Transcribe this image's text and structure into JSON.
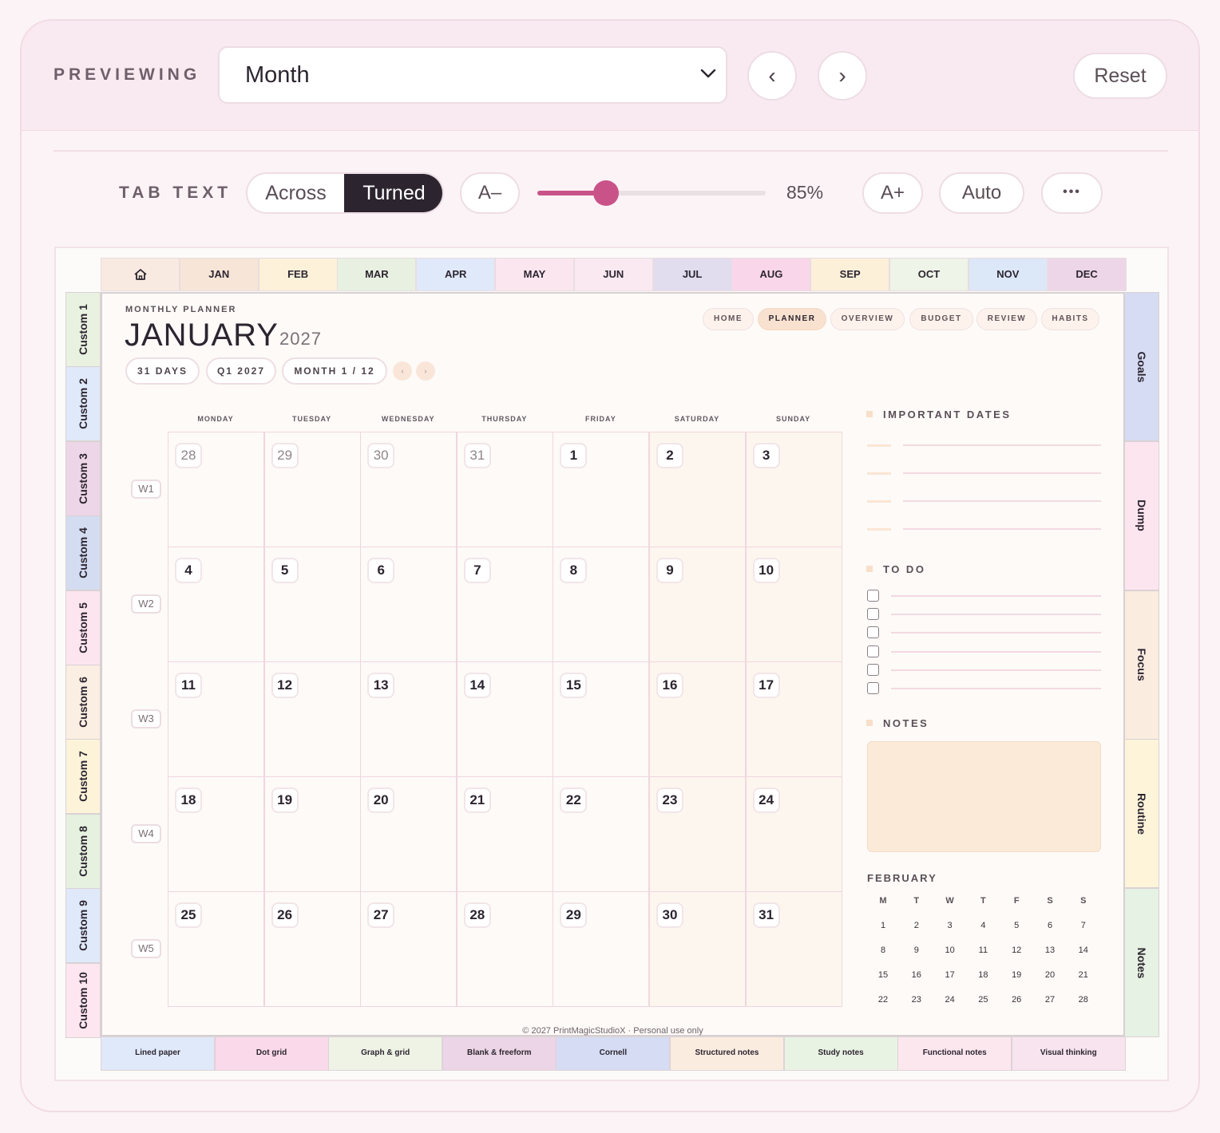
{
  "toolbar": {
    "previewing_label": "PREVIEWING",
    "view_select": "Month",
    "prev_label": "‹",
    "next_label": "›",
    "reset_label": "Reset",
    "tab_text_label": "TAB TEXT",
    "across_label": "Across",
    "turned_label": "Turned",
    "smaller_label": "A–",
    "size_value": 85,
    "size_label": "85%",
    "larger_label": "A+",
    "auto_label": "Auto",
    "more_label": "•••"
  },
  "month_tabs": [
    {
      "label": "",
      "color": "#f9eae1"
    },
    {
      "label": "JAN",
      "color": "#f7e5d7"
    },
    {
      "label": "FEB",
      "color": "#fdf1d9"
    },
    {
      "label": "MAR",
      "color": "#e8f1e1"
    },
    {
      "label": "APR",
      "color": "#e0e9fa"
    },
    {
      "label": "MAY",
      "color": "#fbe6ef"
    },
    {
      "label": "JUN",
      "color": "#fbe9f2"
    },
    {
      "label": "JUL",
      "color": "#e1dcee"
    },
    {
      "label": "AUG",
      "color": "#f9d6e9"
    },
    {
      "label": "SEP",
      "color": "#fdf0d8"
    },
    {
      "label": "OCT",
      "color": "#eef4e7"
    },
    {
      "label": "NOV",
      "color": "#dce7f8"
    },
    {
      "label": "DEC",
      "color": "#edd6e7"
    }
  ],
  "left_tabs": [
    {
      "label": "Custom 1",
      "color": "#e9f2e0"
    },
    {
      "label": "Custom 2",
      "color": "#dfe9fa"
    },
    {
      "label": "Custom 3",
      "color": "#edd6e7"
    },
    {
      "label": "Custom 4",
      "color": "#d4dcf1"
    },
    {
      "label": "Custom 5",
      "color": "#fde5ef"
    },
    {
      "label": "Custom 6",
      "color": "#fbeee2"
    },
    {
      "label": "Custom 7",
      "color": "#fdf3d9"
    },
    {
      "label": "Custom 8",
      "color": "#e6f1e0"
    },
    {
      "label": "Custom 9",
      "color": "#dfe9fa"
    },
    {
      "label": "Custom 10",
      "color": "#fde6ef"
    }
  ],
  "right_tabs": [
    {
      "label": "Goals",
      "color": "#d5dcf3"
    },
    {
      "label": "Dump",
      "color": "#fde5f0"
    },
    {
      "label": "Focus",
      "color": "#fbece0"
    },
    {
      "label": "Routine",
      "color": "#fdf4da"
    },
    {
      "label": "Notes",
      "color": "#e6f2e3"
    }
  ],
  "bottom_tabs": [
    {
      "label": "Lined paper",
      "color": "#e0e9fa"
    },
    {
      "label": "Dot grid",
      "color": "#fad9ea"
    },
    {
      "label": "Graph & grid",
      "color": "#eef3e6"
    },
    {
      "label": "Blank & freeform",
      "color": "#ecd5e6"
    },
    {
      "label": "Cornell",
      "color": "#d5dcf3"
    },
    {
      "label": "Structured notes",
      "color": "#fbece0"
    },
    {
      "label": "Study notes",
      "color": "#e9f3e4"
    },
    {
      "label": "Functional notes",
      "color": "#fde7ef"
    },
    {
      "label": "Visual thinking",
      "color": "#f7e4ee"
    }
  ],
  "page": {
    "kicker": "MONTHLY PLANNER",
    "month": "JANUARY",
    "year": "2027",
    "chips": [
      "31 DAYS",
      "Q1 2027",
      "MONTH 1 / 12"
    ],
    "chip_prev": "‹",
    "chip_next": "›",
    "nav": [
      "HOME",
      "PLANNER",
      "OVERVIEW",
      "BUDGET",
      "REVIEW",
      "HABITS"
    ],
    "weekdays": [
      "MONDAY",
      "TUESDAY",
      "WEDNESDAY",
      "THURSDAY",
      "FRIDAY",
      "SATURDAY",
      "SUNDAY"
    ],
    "weeks": [
      "W1",
      "W2",
      "W3",
      "W4",
      "W5"
    ],
    "days": [
      [
        "28",
        "29",
        "30",
        "31",
        "1",
        "2",
        "3"
      ],
      [
        "4",
        "5",
        "6",
        "7",
        "8",
        "9",
        "10"
      ],
      [
        "11",
        "12",
        "13",
        "14",
        "15",
        "16",
        "17"
      ],
      [
        "18",
        "19",
        "20",
        "21",
        "22",
        "23",
        "24"
      ],
      [
        "25",
        "26",
        "27",
        "28",
        "29",
        "30",
        "31"
      ]
    ],
    "important_dates_label": "IMPORTANT DATES",
    "todo_label": "TO DO",
    "notes_label": "NOTES",
    "mini_month": "FEBRUARY",
    "mini_weekdays": [
      "M",
      "T",
      "W",
      "T",
      "F",
      "S",
      "S"
    ],
    "mini_days": [
      [
        "1",
        "2",
        "3",
        "4",
        "5",
        "6",
        "7"
      ],
      [
        "8",
        "9",
        "10",
        "11",
        "12",
        "13",
        "14"
      ],
      [
        "15",
        "16",
        "17",
        "18",
        "19",
        "20",
        "21"
      ],
      [
        "22",
        "23",
        "24",
        "25",
        "26",
        "27",
        "28"
      ]
    ],
    "footer": "© 2027 PrintMagicStudioX · Personal use only"
  },
  "colors": {
    "accent": "#c95389",
    "dark": "#2c2530",
    "notes_box": "#fbead8",
    "weekend": "#fdf6ef"
  }
}
